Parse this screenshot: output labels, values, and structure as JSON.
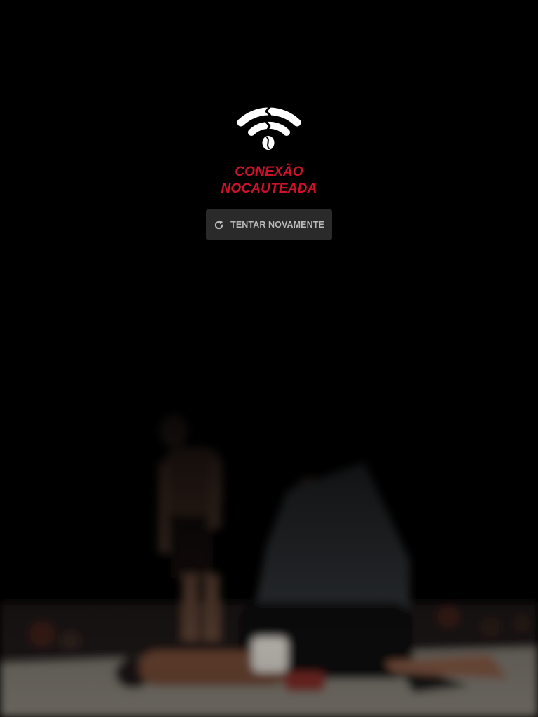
{
  "error": {
    "title_line1": "CONEXÃO",
    "title_line2": "NOCAUTEADA",
    "icon": "broken-wifi-icon",
    "accent_color": "#d0112b"
  },
  "retry_button": {
    "icon": "refresh-icon",
    "label": "TENTAR NOVAMENTE"
  },
  "background": {
    "image": "blurred-fight-knockout-photo"
  }
}
